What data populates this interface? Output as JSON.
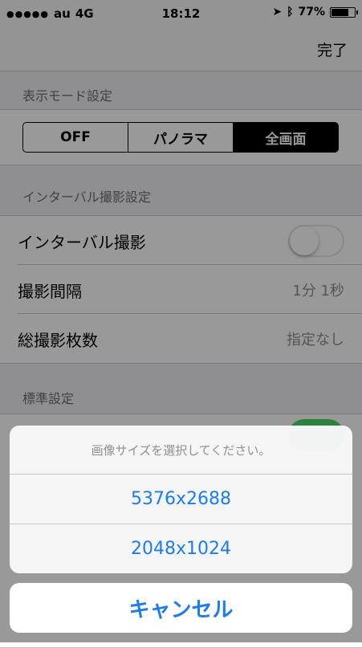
{
  "status_bar": {
    "carrier": "au",
    "network": "4G",
    "time": "18:12",
    "battery_percent": "77%",
    "battery_level": 0.77,
    "icons": [
      "signal-dots-icon",
      "location-arrow-icon",
      "bluetooth-icon",
      "battery-icon"
    ]
  },
  "nav": {
    "done_label": "完了"
  },
  "display_mode": {
    "header": "表示モード設定",
    "segments": [
      "OFF",
      "パノラマ",
      "全画面"
    ],
    "selected": "全画面"
  },
  "interval": {
    "header": "インターバル撮影設定",
    "toggle_label": "インターバル撮影",
    "toggle_on": false,
    "interval_label": "撮影間隔",
    "interval_value": "1分 1秒",
    "total_label": "総撮影枚数",
    "total_value": "指定なし"
  },
  "standard": {
    "header": "標準設定",
    "toggle_on": true
  },
  "action_sheet": {
    "title": "画像サイズを選択してください。",
    "options": [
      "5376x2688",
      "2048x1024"
    ],
    "cancel_label": "キャンセル"
  },
  "colors": {
    "accent": "#1a7cf6",
    "toggle_on": "#4cd964",
    "background": "#efeff4"
  }
}
